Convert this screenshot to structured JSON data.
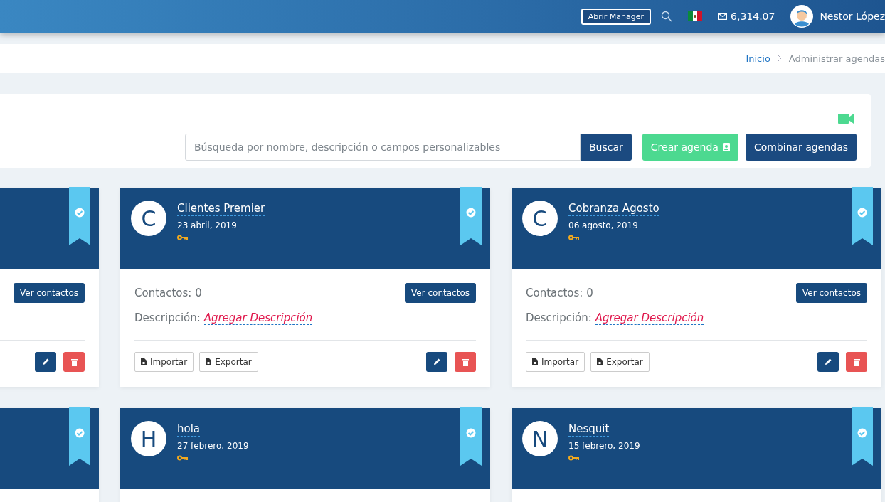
{
  "topbar": {
    "manager_button": "Abrir Manager",
    "balance": "6,314.07",
    "user_name": "Nestor López"
  },
  "breadcrumb": [
    {
      "label": "Inicio",
      "link": true
    },
    {
      "label": "Administrar agendas",
      "link": false
    }
  ],
  "toolbar": {
    "search_placeholder": "Búsqueda por nombre, descripción o campos personalizables",
    "search_button": "Buscar",
    "create_button": "Crear agenda",
    "merge_button": "Combinar agendas"
  },
  "cards": [
    {
      "verified": true,
      "view_button": "Ver contactos"
    },
    {
      "verified": true,
      "letter": "C",
      "title": "Clientes Premier",
      "date": "23 abril, 2019",
      "contacts": "Contactos: 0",
      "description_label": "Descripción:",
      "description_link": "Agregar Descripción",
      "view_button": "Ver contactos",
      "import_button": "Importar",
      "export_button": "Exportar"
    },
    {
      "verified": true,
      "letter": "C",
      "title": "Cobranza Agosto",
      "date": "06 agosto, 2019",
      "contacts": "Contactos: 0",
      "description_label": "Descripción:",
      "description_link": "Agregar Descripción",
      "view_button": "Ver contactos",
      "import_button": "Importar",
      "export_button": "Exportar"
    },
    {
      "verified": true
    },
    {
      "verified": true,
      "letter": "H",
      "title": "hola",
      "date": "27 febrero, 2019"
    },
    {
      "verified": true,
      "letter": "N",
      "title": "Nesquit",
      "date": "15 febrero, 2019"
    }
  ]
}
